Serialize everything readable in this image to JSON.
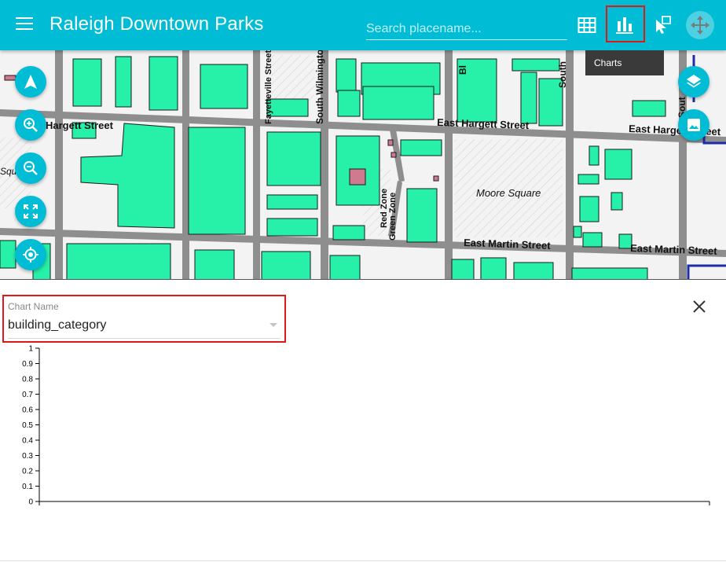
{
  "app": {
    "title": "Raleigh Downtown Parks"
  },
  "search": {
    "placeholder": "Search placename..."
  },
  "toolbar": {
    "buttons": [
      {
        "name": "attribute-table",
        "icon": "table-icon"
      },
      {
        "name": "charts",
        "icon": "bar-chart-icon",
        "selected": true
      },
      {
        "name": "select",
        "icon": "select-cursor-icon"
      },
      {
        "name": "pan",
        "icon": "move-icon"
      }
    ],
    "tooltip": "Charts"
  },
  "map": {
    "controls_left": [
      "navigation-icon",
      "zoom-in-icon",
      "zoom-out-icon",
      "fullscreen-icon",
      "locate-icon"
    ],
    "controls_right": [
      "layers-icon",
      "image-icon"
    ],
    "street_labels": [
      "Hargett Street",
      "East Hargett Street",
      "East Hargett Street",
      "Fayetteville Street",
      "South Wilmington",
      "East Martin Street",
      "East Martin Street",
      "Moore Square",
      "Red Zone",
      "Green Zone",
      "Squ",
      "Sout",
      "Bl",
      "South"
    ],
    "colors": {
      "building": "#27f0a8",
      "road": "#8e8e8e",
      "background": "#f3f3f3"
    }
  },
  "panel": {
    "field_label": "Chart Name",
    "field_value": "building_category"
  },
  "chart_data": {
    "type": "bar",
    "categories": [],
    "values": [],
    "title": "",
    "xlabel": "",
    "ylabel": "",
    "ylim": [
      0,
      1
    ],
    "yticks": [
      "1",
      "0.9",
      "0.8",
      "0.7",
      "0.6",
      "0.5",
      "0.4",
      "0.3",
      "0.2",
      "0.1",
      "0"
    ]
  },
  "colors": {
    "accent": "#00bcd4",
    "highlight": "#e01818",
    "tooltip_bg": "#3a3a3a"
  }
}
